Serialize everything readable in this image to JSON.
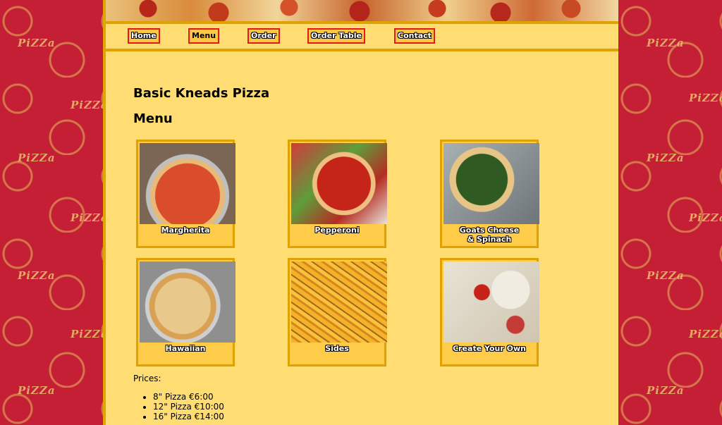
{
  "nav": {
    "items": [
      {
        "label": "Home"
      },
      {
        "label": "Menu"
      },
      {
        "label": "Order"
      },
      {
        "label": "Order Table"
      },
      {
        "label": "Contact"
      }
    ]
  },
  "page": {
    "title": "Basic Kneads Pizza",
    "section_heading": "Menu"
  },
  "menu_items": [
    {
      "label": "Margherita"
    },
    {
      "label": "Pepperoni"
    },
    {
      "label": "Goats Cheese & Spinach"
    },
    {
      "label": "Hawaiian"
    },
    {
      "label": "Sides"
    },
    {
      "label": "Create Your Own"
    }
  ],
  "prices": {
    "label": "Prices:",
    "items": [
      "8\" Pizza €6:00",
      "12\" Pizza €10:00",
      "16\" Pizza €14:00"
    ]
  },
  "decor": {
    "pattern_word": "PiZZa"
  },
  "colors": {
    "accent_border": "#e5191b",
    "page_bg": "#ffdd72",
    "side_bg": "#c41f35"
  }
}
